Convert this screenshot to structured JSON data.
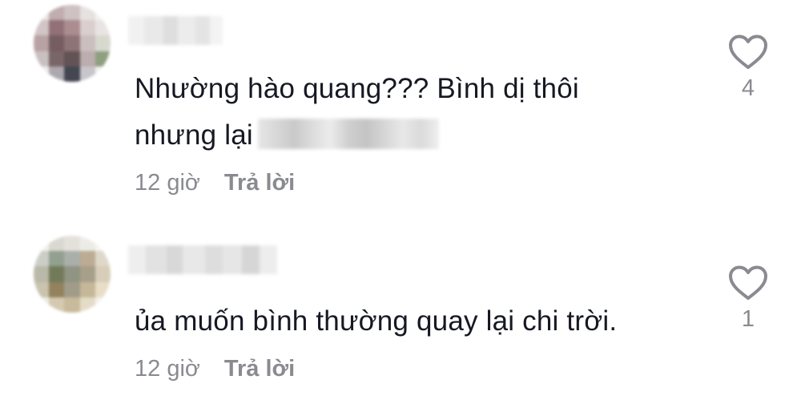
{
  "comments": [
    {
      "text_line1": "Nhường hào quang??? Bình dị thôi",
      "text_line2": "nhưng lại",
      "time": "12 giờ",
      "reply_label": "Trả lời",
      "likes": "4",
      "like_icon": "heart-outline-icon"
    },
    {
      "text_line1": "ủa muốn bình thường quay lại chi trời.",
      "time": "12 giờ",
      "reply_label": "Trả lời",
      "likes": "1",
      "like_icon": "heart-outline-icon"
    }
  ],
  "colors": {
    "text": "#161823",
    "meta": "#8a8b91",
    "icon": "#8a8b91"
  }
}
